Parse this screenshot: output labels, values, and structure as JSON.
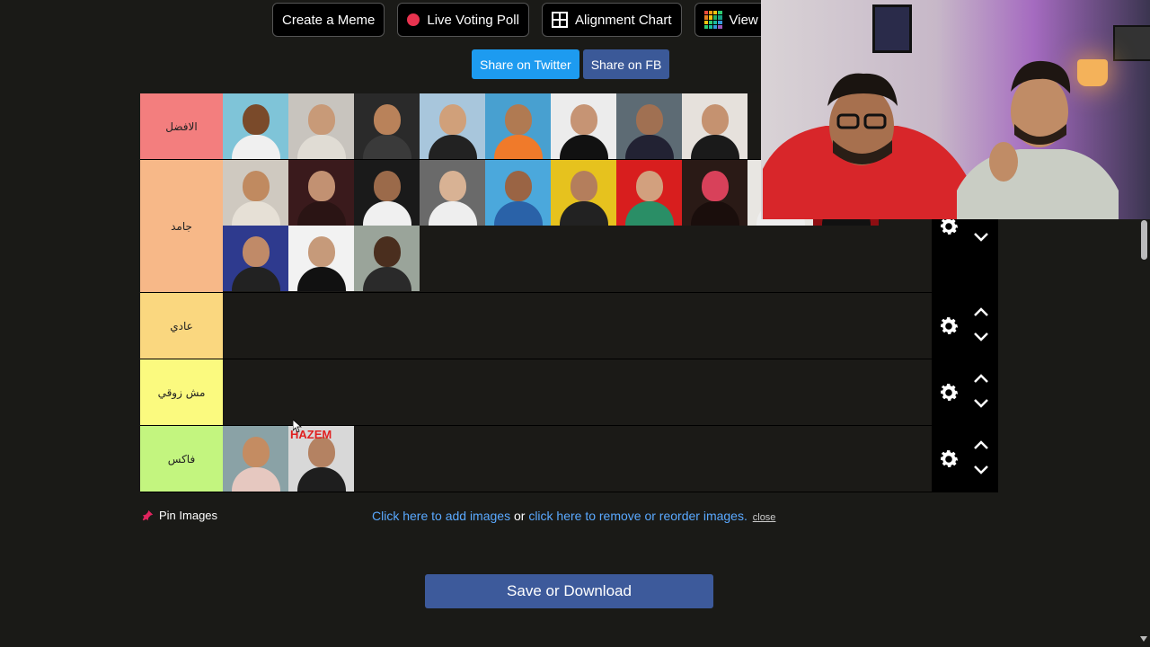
{
  "nav": {
    "create_meme": "Create a Meme",
    "live_poll": "Live Voting Poll",
    "alignment_chart": "Alignment Chart",
    "view": "View C"
  },
  "share": {
    "twitter": "Share on Twitter",
    "fb": "Share on FB",
    "twitter_color": "#1da1f2",
    "fb_color": "#3b5998"
  },
  "tiers": [
    {
      "label": "الافضل",
      "color": "#f37e7e",
      "thumbs": [
        {
          "bg": "#7fc4d8",
          "skin": "#7a4a2a",
          "shirt": "#f0f0f0"
        },
        {
          "bg": "#c8c4be",
          "skin": "#c89a78",
          "shirt": "#e0dcd4"
        },
        {
          "bg": "#2a2a2a",
          "skin": "#b9825a",
          "shirt": "#3a3a3a"
        },
        {
          "bg": "#a8c6dc",
          "skin": "#d0a07a",
          "shirt": "#222"
        },
        {
          "bg": "#48a0d0",
          "skin": "#b07a52",
          "shirt": "#f07a2a"
        },
        {
          "bg": "#ececec",
          "skin": "#c69474",
          "shirt": "#111"
        },
        {
          "bg": "#5d6b74",
          "skin": "#a07052",
          "shirt": "#223"
        },
        {
          "bg": "#e6e1dc",
          "skin": "#c59270",
          "shirt": "#1a1a1a"
        }
      ]
    },
    {
      "label": "جامد",
      "color": "#f7b888",
      "thumbs": [
        {
          "bg": "#cfc9c0",
          "skin": "#c08a60",
          "shirt": "#e6e0d6"
        },
        {
          "bg": "#3a1a1c",
          "skin": "#c29172",
          "shirt": "#2a1414"
        },
        {
          "bg": "#1a1a1a",
          "skin": "#9b6a4a",
          "shirt": "#f0f0f0"
        },
        {
          "bg": "#6a6a6a",
          "skin": "#d8b294",
          "shirt": "#eee"
        },
        {
          "bg": "#4ba8dc",
          "skin": "#9a6444",
          "shirt": "#2a62a8"
        },
        {
          "bg": "#e6c21e",
          "skin": "#b47e5c",
          "shirt": "#222"
        },
        {
          "bg": "#d81e1e",
          "skin": "#d2a07e",
          "shirt": "#2a8e66"
        },
        {
          "bg": "#2a1a16",
          "skin": "#d8415a",
          "shirt": "#1a0e0c"
        },
        {
          "bg": "#e8e6e2",
          "skin": "#5a3a24",
          "shirt": "#eee"
        },
        {
          "bg": "#8e0e12",
          "skin": "#6a3e26",
          "shirt": "#111"
        },
        {
          "bg": "#2e3a8e",
          "skin": "#c08a68",
          "shirt": "#222"
        },
        {
          "bg": "#f2f2f2",
          "skin": "#c69a7a",
          "shirt": "#111"
        },
        {
          "bg": "#9aa49a",
          "skin": "#4a2e1e",
          "shirt": "#2a2a2a"
        }
      ]
    },
    {
      "label": "عادي",
      "color": "#fad77f",
      "thumbs": []
    },
    {
      "label": "مش زوقي",
      "color": "#fbfa7f",
      "thumbs": []
    },
    {
      "label": "فاكس",
      "color": "#c3f57f",
      "thumbs": [
        {
          "bg": "#8aa2a6",
          "skin": "#c48c62",
          "shirt": "#e6c8c0"
        },
        {
          "bg": "#d8d8d8",
          "skin": "#b48262",
          "shirt": "#1e1e1e",
          "caption": "HAZEM"
        }
      ]
    }
  ],
  "bottom": {
    "pin_label": "Pin Images",
    "add_images": "Click here to add images",
    "or": "or",
    "remove_images": "click here to remove or reorder images.",
    "close": "close",
    "save": "Save or Download"
  }
}
